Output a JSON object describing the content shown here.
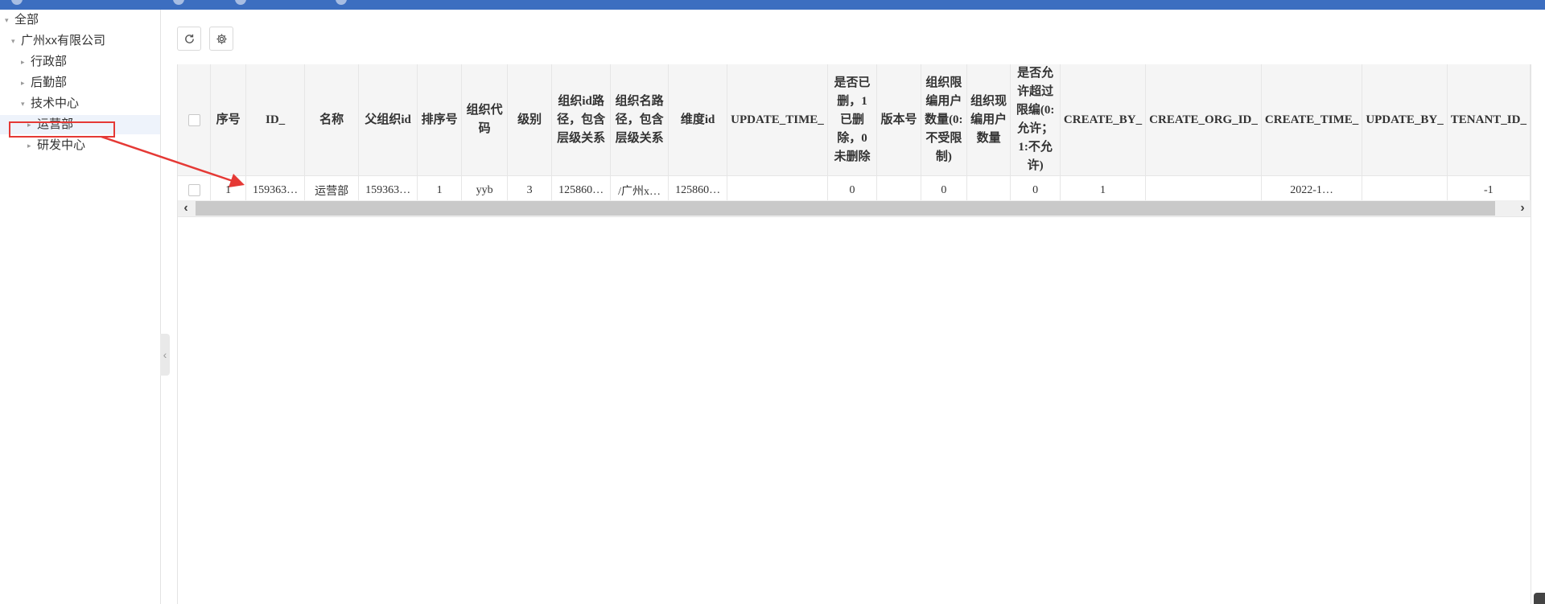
{
  "tree": {
    "nodes": [
      {
        "label": "全部",
        "level": 0,
        "caret": "down"
      },
      {
        "label": "广州xx有限公司",
        "level": 1,
        "caret": "down"
      },
      {
        "label": "行政部",
        "level": 2,
        "caret": "right"
      },
      {
        "label": "后勤部",
        "level": 2,
        "caret": "right"
      },
      {
        "label": "技术中心",
        "level": 2,
        "caret": "down"
      },
      {
        "label": "运营部",
        "level": 3,
        "caret": "right",
        "selected": true
      },
      {
        "label": "研发中心",
        "level": 3,
        "caret": "right"
      }
    ]
  },
  "toolbar": {
    "refresh_icon": "refresh-icon",
    "settings_icon": "gear-icon"
  },
  "table": {
    "columns": [
      "序号",
      "ID_",
      "名称",
      "父组织id",
      "排序号",
      "组织代码",
      "级别",
      "组织id路径，包含层级关系",
      "组织名路径，包含层级关系",
      "维度id",
      "UPDATE_TIME_",
      "是否已删，1已删除，0未删除",
      "版本号",
      "组织限编用户数量(0:不受限制)",
      "组织现编用户数量",
      "是否允许超过限编(0:允许；1:不允许)",
      "CREATE_BY_",
      "CREATE_ORG_ID_",
      "CREATE_TIME_",
      "UPDATE_BY_",
      "TENANT_ID_"
    ],
    "rows": [
      [
        "1",
        "159363…",
        "运营部",
        "159363…",
        "1",
        "yyb",
        "3",
        "125860…",
        "/广州x…",
        "125860…",
        "",
        "0",
        "",
        "0",
        "",
        "0",
        "1",
        "",
        "2022-1…",
        "",
        "-1"
      ]
    ]
  },
  "colors": {
    "topbar": "#3c6ec0",
    "annotation": "#e53935",
    "header_bg": "#f5f5f5"
  }
}
